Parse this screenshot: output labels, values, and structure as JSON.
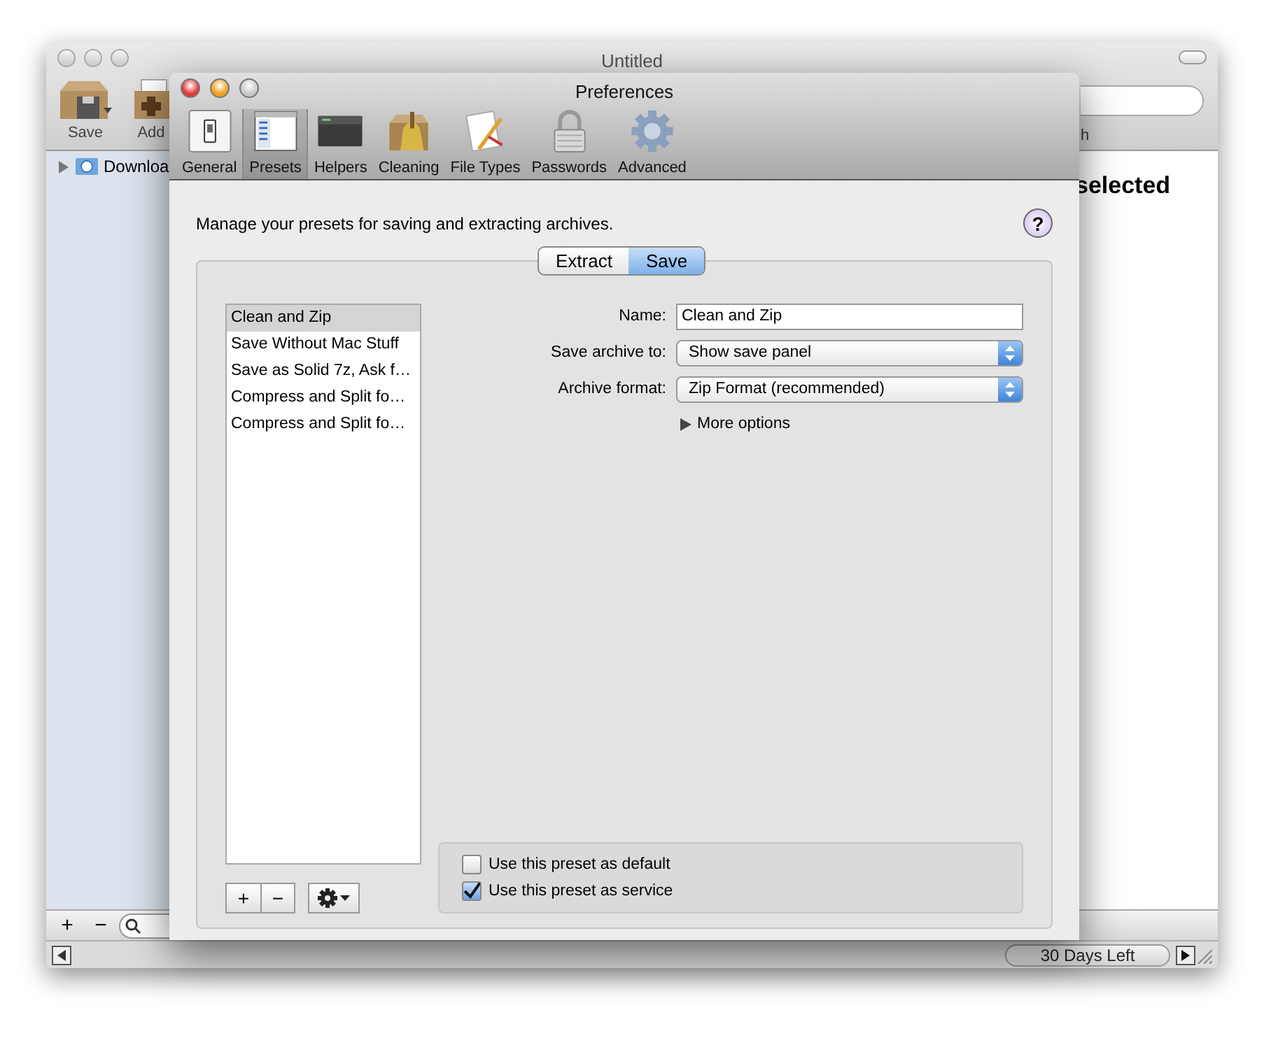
{
  "back_window": {
    "title": "Untitled",
    "toolbar": [
      {
        "label": "Save"
      },
      {
        "label": "Add"
      }
    ],
    "search_label": "h",
    "sidebar": [
      {
        "label": "Downloa",
        "expanded": false
      }
    ],
    "heading": "selected",
    "bottom_buttons": [
      "+",
      "−"
    ],
    "status": "30 Days Left"
  },
  "preferences": {
    "title": "Preferences",
    "toolbar": [
      {
        "label": "General",
        "selected": false
      },
      {
        "label": "Presets",
        "selected": true
      },
      {
        "label": "Helpers",
        "selected": false
      },
      {
        "label": "Cleaning",
        "selected": false
      },
      {
        "label": "File Types",
        "selected": false
      },
      {
        "label": "Passwords",
        "selected": false
      },
      {
        "label": "Advanced",
        "selected": false
      }
    ],
    "description": "Manage your presets for saving and extracting archives.",
    "help": "?",
    "tabs": [
      {
        "label": "Extract",
        "selected": false
      },
      {
        "label": "Save",
        "selected": true
      }
    ],
    "presets": [
      {
        "label": "Clean and Zip",
        "selected": true
      },
      {
        "label": "Save Without Mac Stuff",
        "selected": false
      },
      {
        "label": "Save as Solid 7z, Ask f…",
        "selected": false
      },
      {
        "label": "Compress and Split fo…",
        "selected": false
      },
      {
        "label": "Compress and Split fo…",
        "selected": false
      }
    ],
    "list_buttons": [
      "+",
      "−"
    ],
    "form": {
      "name_label": "Name:",
      "name_value": "Clean and Zip",
      "save_to_label": "Save archive to:",
      "save_to_value": "Show save panel",
      "format_label": "Archive format:",
      "format_value": "Zip Format (recommended)"
    },
    "more_options": {
      "label": "More options",
      "expanded": false
    },
    "options": [
      {
        "label": "Use this preset as default",
        "checked": false
      },
      {
        "label": "Use this preset as service",
        "checked": true
      }
    ]
  }
}
